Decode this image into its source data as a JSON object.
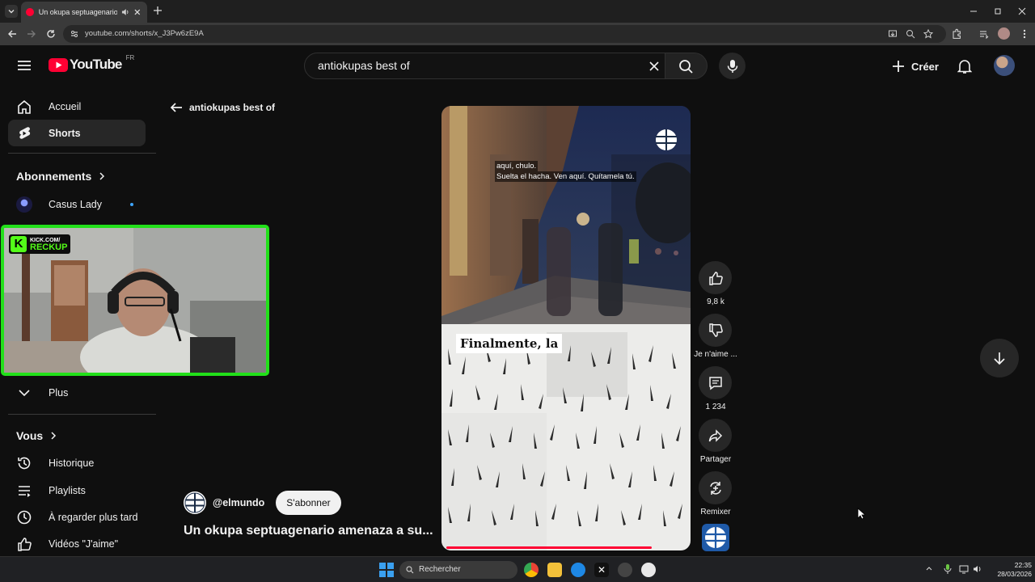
{
  "browser": {
    "tab_title": "Un okupa septuagenario ar",
    "url": "youtube.com/shorts/x_J3Pw6zE9A"
  },
  "header": {
    "logo_text": "YouTube",
    "region": "FR",
    "search_value": "antiokupas best of",
    "create_label": "Créer"
  },
  "sidebar": {
    "home": "Accueil",
    "shorts": "Shorts",
    "subscriptions": "Abonnements",
    "sub_channel": "Casus Lady",
    "more": "Plus",
    "you": "Vous",
    "history": "Historique",
    "playlists": "Playlists",
    "watch_later": "À regarder plus tard",
    "liked": "Vidéos \"J'aime\""
  },
  "webcam": {
    "badge_top": "KICK.COM/",
    "badge_bottom": "RECKUP"
  },
  "shorts_page": {
    "back_label": "antiokupas best of",
    "caption_line1": "aquí, chulo.",
    "caption_line2": "Suelta el hacha. Ven aquí. Quítamela tú.",
    "overlay_text": "Finalmente, la",
    "likes": "9,8 k",
    "dislike_label": "Je n'aime ...",
    "comments": "1 234",
    "share_label": "Partager",
    "remix_label": "Remixer",
    "channel": "@elmundo",
    "subscribe_label": "S'abonner",
    "title": "Un okupa septuagenario amenaza a su..."
  },
  "taskbar": {
    "search_placeholder": "Rechercher",
    "time": "22:35",
    "date": "28/03/2026"
  },
  "colors": {
    "youtube_red": "#ff0033",
    "webcam_border": "#22e01a",
    "kick_green": "#53fc18"
  }
}
